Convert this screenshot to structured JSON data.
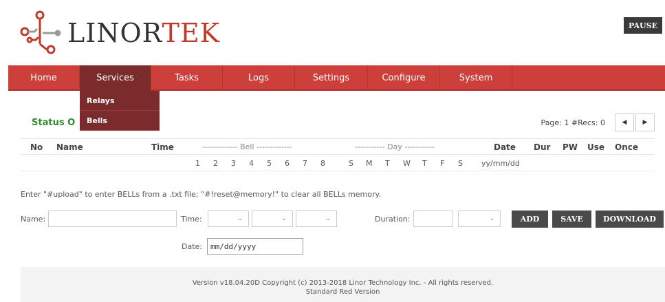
{
  "header": {
    "logo_text_a": "LINOR",
    "logo_text_b": "TEK",
    "pause_label": "PAUSE"
  },
  "nav": {
    "items": [
      {
        "label": "Home"
      },
      {
        "label": "Services"
      },
      {
        "label": "Tasks"
      },
      {
        "label": "Logs"
      },
      {
        "label": "Settings"
      },
      {
        "label": "Configure"
      },
      {
        "label": "System"
      }
    ],
    "active": "Services",
    "dropdown": [
      "Relays",
      "Bells"
    ]
  },
  "status": {
    "title": "Status O",
    "page_info": "Page: 1 #Recs: 0",
    "columns": {
      "no": "No",
      "name": "Name",
      "time": "Time",
      "bell": "------------- Bell -------------",
      "day": "----------- Day -----------",
      "date": "Date",
      "dur": "Dur",
      "pw": "PW",
      "use": "Use",
      "once": "Once"
    },
    "bell_numbers": [
      "1",
      "2",
      "3",
      "4",
      "5",
      "6",
      "7",
      "8"
    ],
    "day_letters": [
      "S",
      "M",
      "T",
      "W",
      "T",
      "F",
      "S"
    ],
    "date_format": "yy/mm/dd"
  },
  "hint": "Enter \"#upload\" to enter BELLs from a .txt file; \"#!reset@memory!\" to clear all BELLs memory.",
  "form": {
    "name_label": "Name:",
    "time_label": "Time:",
    "duration_label": "Duration:",
    "date_label": "Date:",
    "date_placeholder": "mm/dd/yyyy",
    "add_label": "ADD",
    "save_label": "SAVE",
    "download_label": "DOWNLOAD"
  },
  "footer": {
    "line1": "Version v18.04.20D Copyright (c) 2013-2018 Linor Technology Inc. - All rights reserved.",
    "line2": "Standard Red Version"
  },
  "colors": {
    "accent": "#cc3f3a",
    "active_nav": "#7b2b2b",
    "status_green": "#2e8b2e",
    "button": "#4a4a4a"
  }
}
